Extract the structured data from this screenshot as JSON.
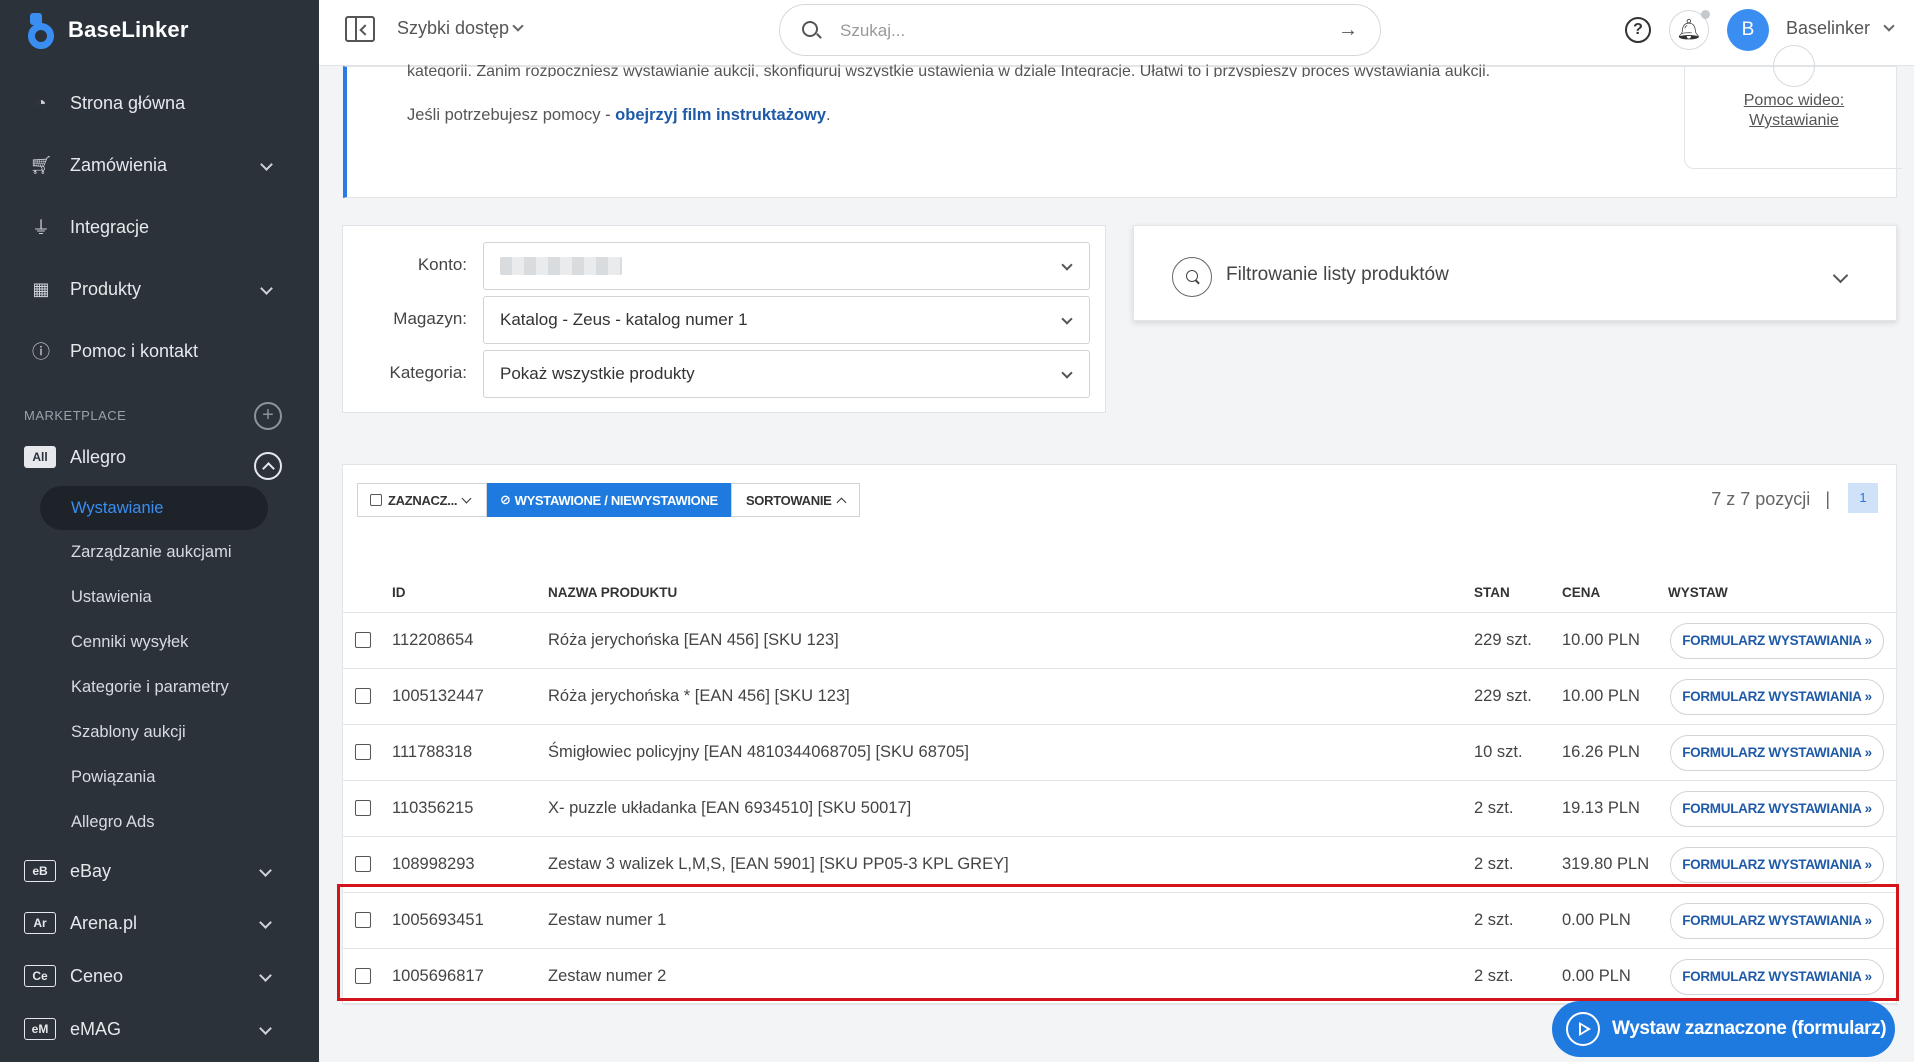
{
  "brand": {
    "name": "BaseLinker"
  },
  "sidebar": {
    "nav": [
      {
        "label": "Strona główna",
        "icon": "dashboard-icon",
        "chevron": false
      },
      {
        "label": "Zamówienia",
        "icon": "cart-icon",
        "chevron": true
      },
      {
        "label": "Integracje",
        "icon": "plug-icon",
        "chevron": false
      },
      {
        "label": "Produkty",
        "icon": "warehouse-icon",
        "chevron": true
      },
      {
        "label": "Pomoc i kontakt",
        "icon": "help-circle-icon",
        "chevron": false
      }
    ],
    "marketplace_label": "MARKETPLACE",
    "allegro": {
      "badge": "All",
      "label": "Allegro"
    },
    "allegro_sub": [
      "Wystawianie",
      "Zarządzanie aukcjami",
      "Ustawienia",
      "Cenniki wysyłek",
      "Kategorie i parametry",
      "Szablony aukcji",
      "Powiązania",
      "Allegro Ads"
    ],
    "marketplaces": [
      {
        "badge": "eB",
        "label": "eBay"
      },
      {
        "badge": "Ar",
        "label": "Arena.pl"
      },
      {
        "badge": "Ce",
        "label": "Ceneo"
      },
      {
        "badge": "eM",
        "label": "eMAG"
      }
    ]
  },
  "topbar": {
    "quick_access": "Szybki dostęp",
    "search_placeholder": "Szukaj...",
    "avatar_letter": "B",
    "user_name": "Baselinker"
  },
  "info": {
    "cut_line": "kategorii. Zanim rozpoczniesz wystawianie aukcji, skonfiguruj wszystkie ustawienia w dziale Integracje. Ułatwi to i przyspieszy proces wystawiania aukcji.",
    "help_prefix": "Jeśli potrzebujesz pomocy - ",
    "help_link": "obejrzyj film instruktażowy",
    "help_suffix": ".",
    "video_help_line1": "Pomoc wideo:",
    "video_help_line2": "Wystawianie"
  },
  "selectors": {
    "konto_label": "Konto:",
    "magazyn_label": "Magazyn:",
    "magazyn_value": "Katalog - Zeus - katalog numer 1",
    "kategoria_label": "Kategoria:",
    "kategoria_value": "Pokaż wszystkie produkty"
  },
  "filter": {
    "title": "Filtrowanie listy produktów"
  },
  "toolbar": {
    "select_label": "ZAZNACZ...",
    "listed_label": "WYSTAWIONE / NIEWYSTAWIONE",
    "sort_label": "SORTOWANIE",
    "count_text": "7 z 7 pozycji",
    "separator": "|",
    "page": "1"
  },
  "table": {
    "headers": {
      "id": "ID",
      "name": "NAZWA PRODUKTU",
      "stock": "STAN",
      "price": "CENA",
      "action": "WYSTAW"
    },
    "action_label": "FORMULARZ WYSTAWIANIA »",
    "rows": [
      {
        "id": "112208654",
        "name": "Róża jerychońska [EAN 456] [SKU 123]",
        "stock": "229 szt.",
        "price": "10.00 PLN"
      },
      {
        "id": "1005132447",
        "name": "Róża jerychońska * [EAN 456] [SKU 123]",
        "stock": "229 szt.",
        "price": "10.00 PLN"
      },
      {
        "id": "111788318",
        "name": "Śmigłowiec policyjny [EAN 4810344068705] [SKU 68705]",
        "stock": "10 szt.",
        "price": "16.26 PLN"
      },
      {
        "id": "110356215",
        "name": "X- puzzle układanka [EAN 6934510] [SKU 50017]",
        "stock": "2 szt.",
        "price": "19.13 PLN"
      },
      {
        "id": "108998293",
        "name": "Zestaw 3 walizek L,M,S, [EAN 5901] [SKU PP05-3 KPL GREY]",
        "stock": "2 szt.",
        "price": "319.80 PLN"
      },
      {
        "id": "1005693451",
        "name": "Zestaw numer 1",
        "stock": "2 szt.",
        "price": "0.00 PLN"
      },
      {
        "id": "1005696817",
        "name": "Zestaw numer 2",
        "stock": "2 szt.",
        "price": "0.00 PLN"
      }
    ]
  },
  "fab": {
    "label": "Wystaw zaznaczone (formularz)"
  },
  "colors": {
    "sidebar_bg": "#2b323a",
    "accent": "#1f7ae0",
    "highlight": "#d3141b"
  }
}
